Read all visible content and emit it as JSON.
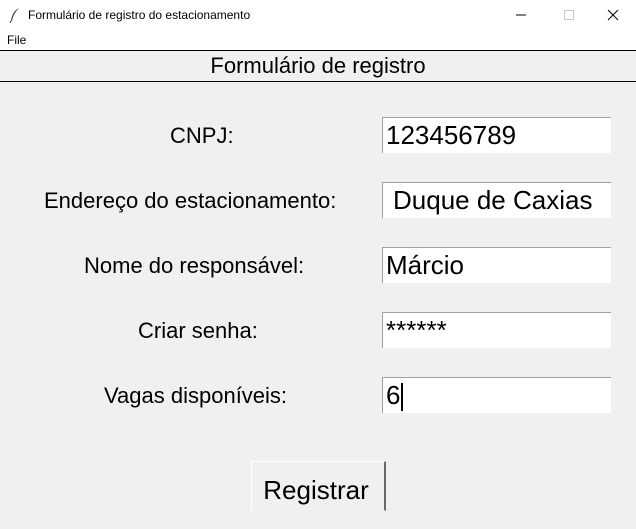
{
  "window": {
    "title": "Formulário de registro do estacionamento",
    "icon": "feather-icon"
  },
  "menu": {
    "items": [
      {
        "label": "File"
      }
    ]
  },
  "form": {
    "heading": "Formulário de registro",
    "fields": [
      {
        "label": "CNPJ:",
        "value": "123456789"
      },
      {
        "label": "Endereço do estacionamento:",
        "value": "Duque de Caxias"
      },
      {
        "label": "Nome do responsável:",
        "value": "Márcio"
      },
      {
        "label": "Criar senha:",
        "value": "******"
      },
      {
        "label": "Vagas disponíveis:",
        "value": "6"
      }
    ],
    "submit_label": "Registrar"
  }
}
